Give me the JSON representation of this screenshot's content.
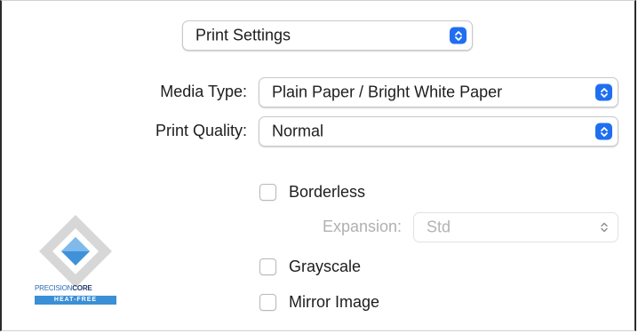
{
  "header": {
    "settings_menu_value": "Print Settings"
  },
  "form": {
    "media_type": {
      "label": "Media Type:",
      "value": "Plain Paper / Bright White Paper"
    },
    "print_quality": {
      "label": "Print Quality:",
      "value": "Normal"
    },
    "borderless": {
      "label": "Borderless",
      "checked": false
    },
    "expansion": {
      "label": "Expansion:",
      "value": "Std",
      "enabled": false
    },
    "grayscale": {
      "label": "Grayscale",
      "checked": false
    },
    "mirror_image": {
      "label": "Mirror Image",
      "checked": false
    }
  },
  "logo": {
    "brand_part1": "PRECISION",
    "brand_part2": "CORE",
    "tagline": "HEAT-FREE"
  },
  "colors": {
    "accent": "#1f6ff0",
    "logo_blue": "#3a8fd6",
    "disabled_text": "#b0b0b0"
  },
  "icons": {
    "popup_stepper": "chevron-up-down-icon",
    "logo": "precisioncore-diamond-logo"
  }
}
